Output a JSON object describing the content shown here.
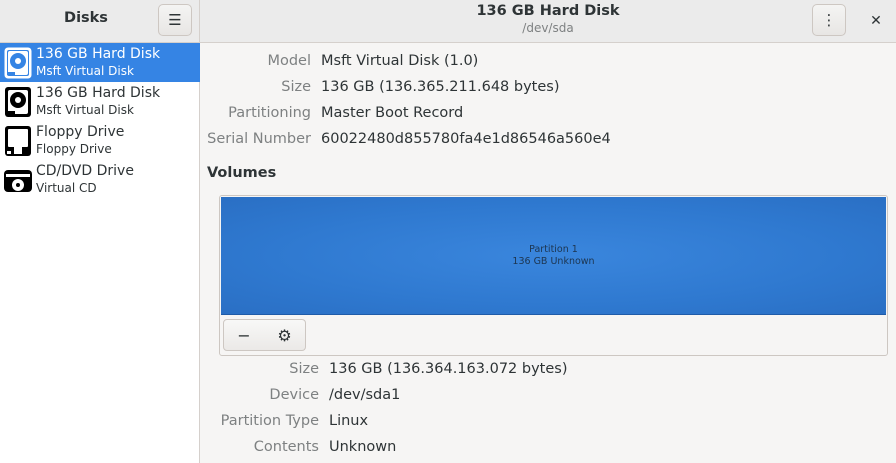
{
  "sidebar_header": {
    "title": "Disks"
  },
  "header": {
    "title": "136 GB Hard Disk",
    "subtitle": "/dev/sda"
  },
  "drives": [
    {
      "name": "136 GB Hard Disk",
      "sub": "Msft Virtual Disk",
      "icon": "hard-disk-icon",
      "selected": true
    },
    {
      "name": "136 GB Hard Disk",
      "sub": "Msft Virtual Disk",
      "icon": "hard-disk-icon",
      "selected": false
    },
    {
      "name": "Floppy Drive",
      "sub": "Floppy Drive",
      "icon": "floppy-icon",
      "selected": false
    },
    {
      "name": "CD/DVD Drive",
      "sub": "Virtual CD",
      "icon": "optical-drive-icon",
      "selected": false
    }
  ],
  "disk_props": {
    "model_label": "Model",
    "model_value": "Msft Virtual Disk (1.0)",
    "size_label": "Size",
    "size_value": "136 GB (136.365.211.648 bytes)",
    "partitioning_label": "Partitioning",
    "partitioning_value": "Master Boot Record",
    "serial_label": "Serial Number",
    "serial_value": "60022480d855780fa4e1d86546a560e4"
  },
  "volumes": {
    "heading": "Volumes",
    "partition_name": "Partition 1",
    "partition_desc": "136 GB Unknown",
    "minus_label": "−",
    "gear_label": "⚙"
  },
  "partition_props": {
    "size_label": "Size",
    "size_value": "136 GB (136.364.163.072 bytes)",
    "device_label": "Device",
    "device_value": "/dev/sda1",
    "type_label": "Partition Type",
    "type_value": "Linux",
    "contents_label": "Contents",
    "contents_value": "Unknown"
  },
  "colors": {
    "accent": "#3584e4",
    "partition": "#3a86dd"
  }
}
